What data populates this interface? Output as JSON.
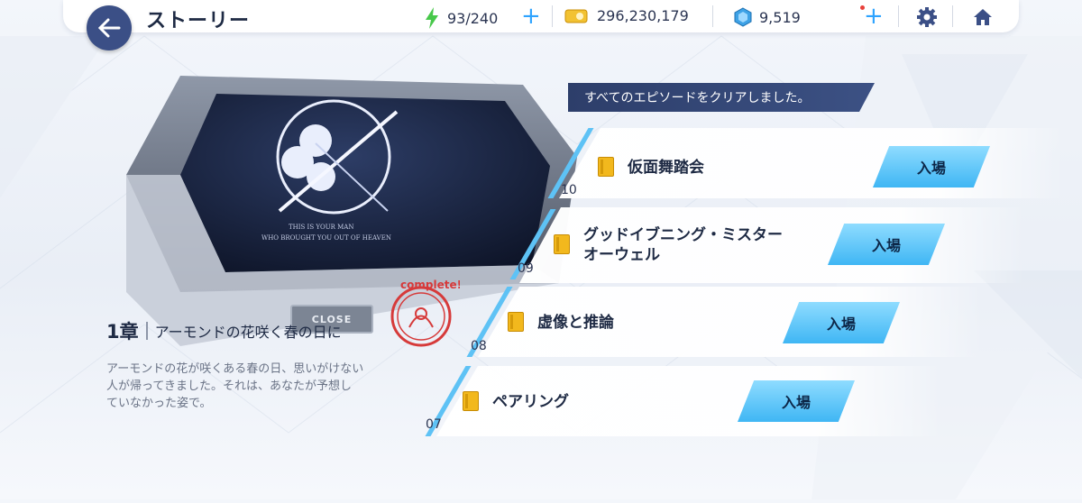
{
  "header": {
    "title": "ストーリー",
    "stamina": "93/240",
    "coins": "296,230,179",
    "gems": "9,519"
  },
  "chapter": {
    "number": "1章",
    "name": "アーモンドの花咲く春の日に",
    "description_lines": [
      "アーモンドの花が咲くある春の日、思いがけない",
      "人が帰ってきました。それは、あなたが予想し",
      "ていなかった姿で。"
    ],
    "close_label": "CLOSE",
    "card_line1": "THIS IS YOUR MAN",
    "card_line2": "WHO BROUGHT YOU OUT OF HEAVEN",
    "stamp_text": "complete!"
  },
  "notice": "すべてのエピソードをクリアしました。",
  "episodes": [
    {
      "num": "10",
      "title_line1": "仮面舞踏会",
      "title_line2": "",
      "button": "入場"
    },
    {
      "num": "09",
      "title_line1": "グッドイブニング・ミスター",
      "title_line2": "オーウェル",
      "button": "入場"
    },
    {
      "num": "08",
      "title_line1": "虚像と推論",
      "title_line2": "",
      "button": "入場"
    },
    {
      "num": "07",
      "title_line1": "ペアリング",
      "title_line2": "",
      "button": "入場"
    }
  ],
  "colors": {
    "accent": "#2ea3ff",
    "dark": "#3b4f86",
    "button": "#3fb6f4"
  },
  "icons": [
    "back-arrow-icon",
    "stamina-icon",
    "coin-icon",
    "gem-icon",
    "plus-icon",
    "settings-icon",
    "home-icon",
    "book-icon"
  ]
}
